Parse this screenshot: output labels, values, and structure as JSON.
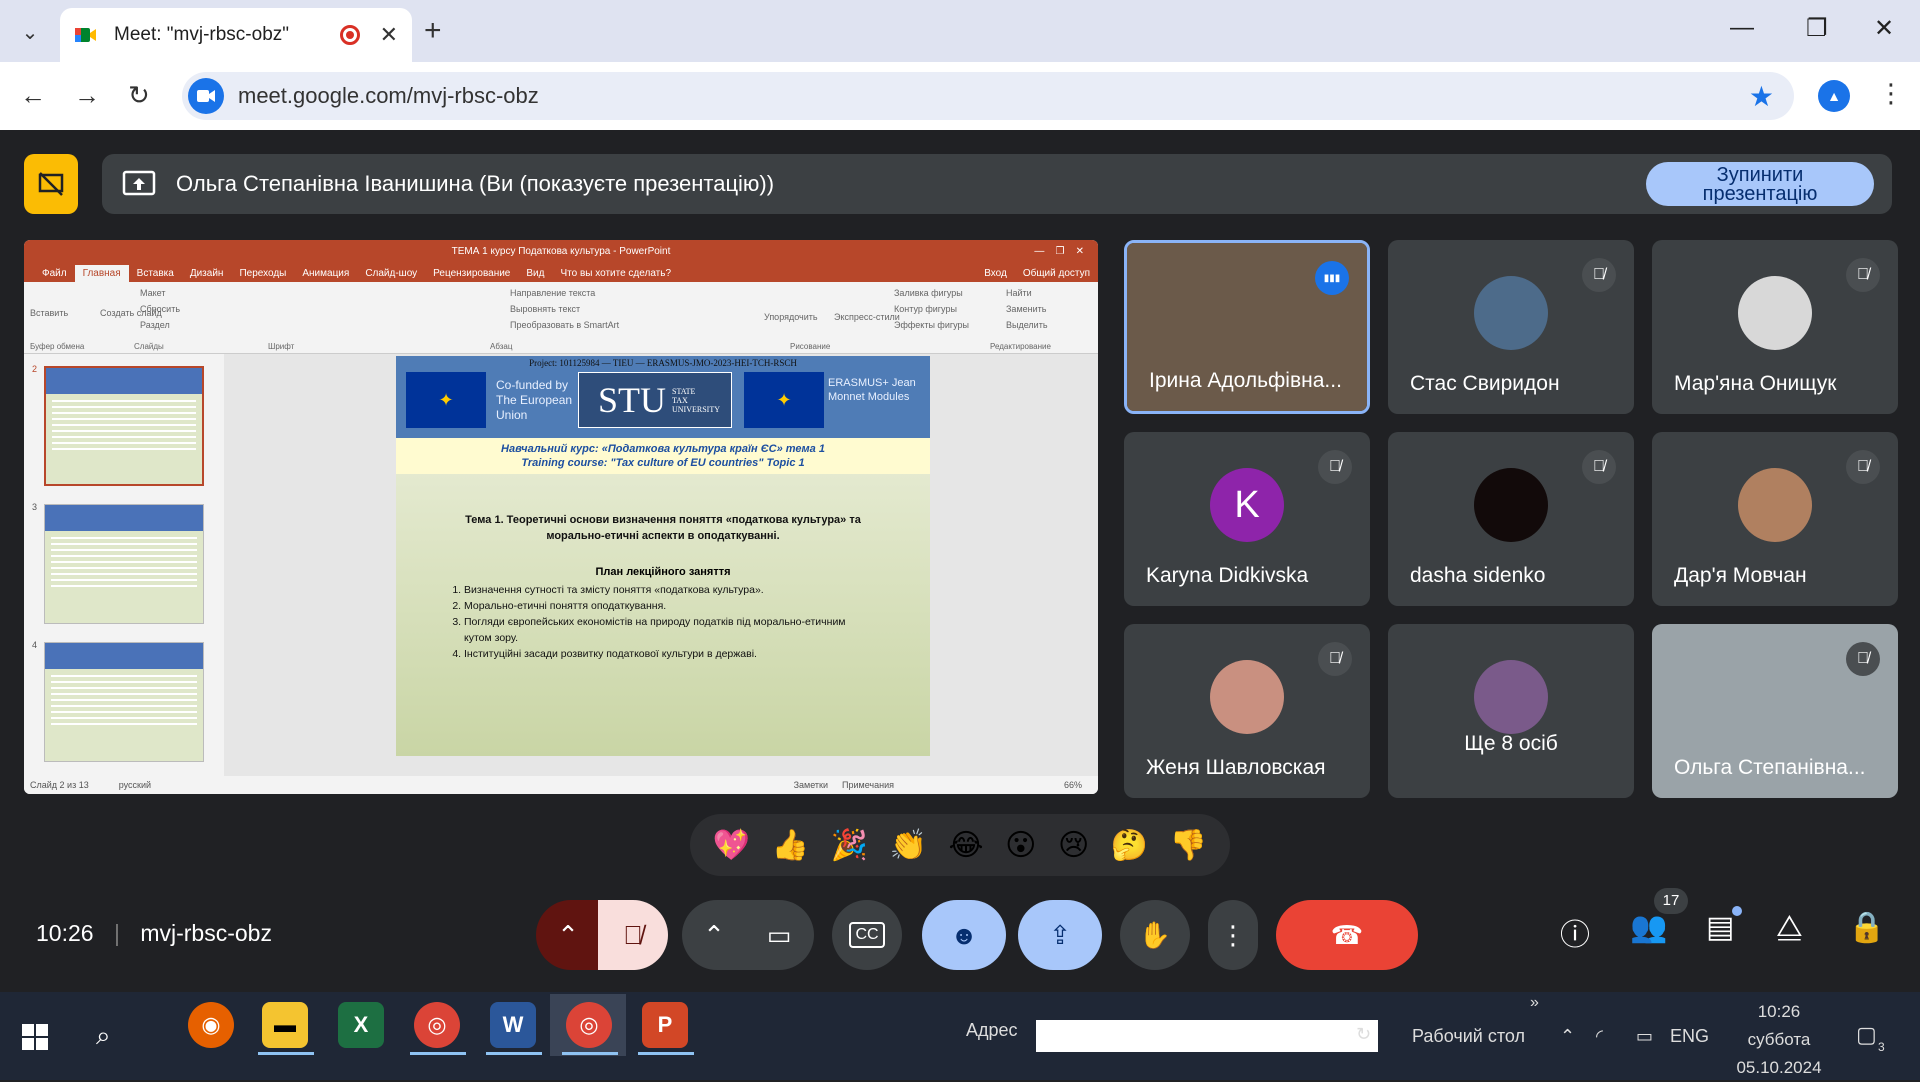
{
  "browser": {
    "tab_title": "Meet: \"mvj-rbsc-obz\"",
    "url": "meet.google.com/mvj-rbsc-obz",
    "minimize": "—",
    "restore": "❐",
    "close": "✕"
  },
  "presentation_bar": {
    "label": "Ольга Степанівна Іванишина (Ви (показуєте презентацію))",
    "stop_line1": "Зупинити",
    "stop_line2": "презентацію"
  },
  "powerpoint": {
    "window_title": "ТЕМА 1  курсу Податкова культура - PowerPoint",
    "menu": [
      "Файл",
      "Главная",
      "Вставка",
      "Дизайн",
      "Переходы",
      "Анимация",
      "Слайд-шоу",
      "Рецензирование",
      "Вид",
      "Что вы хотите сделать?"
    ],
    "login": "Вход",
    "share": "Общий доступ",
    "ribbon_groups": [
      "Буфер обмена",
      "Слайды",
      "Шрифт",
      "Абзац",
      "Рисование",
      "Редактирование"
    ],
    "ribbon_items": [
      "Вставить",
      "Создать слайд",
      "Макет",
      "Сбросить",
      "Раздел",
      "Направление текста",
      "Выровнять текст",
      "Преобразовать в SmartArt",
      "Упорядочить",
      "Экспресс-стили",
      "Заливка фигуры",
      "Контур фигуры",
      "Эффекты фигуры",
      "Найти",
      "Заменить",
      "Выделить"
    ],
    "thumb_numbers": [
      "2",
      "3",
      "4"
    ],
    "slide": {
      "project": "Project: 101125984 — TIEU — ERASMUS-JMO-2023-HEI-TCH-RSCH",
      "cofunded": "Co-funded by The European Union",
      "stu": "STU",
      "stu_sub": "STATE TAX UNIVERSITY",
      "erasmus": "ERASMUS+ Jean Monnet Modules",
      "course_ua": "Навчальний курс: «Податкова культура країн ЄС» тема 1",
      "course_en": "Training course: \"Tax culture of EU countries\" Topic 1",
      "topic": "Тема 1. Теоретичні основи визначення поняття «податкова культура» та морально-етичні аспекти в оподаткуванні.",
      "plan_title": "План лекційного заняття",
      "plan": [
        "Визначення сутності та змісту поняття «податкова культура».",
        "Морально-етичні поняття оподаткування.",
        "Погляди європейських економістів на природу податків під морально-етичним кутом зору.",
        "Інституційні засади розвитку податкової культури в державі."
      ]
    },
    "status": {
      "slide": "Слайд 2 из 13",
      "lang": "русский",
      "notes": "Заметки",
      "comments": "Примечания",
      "zoom": "66%"
    }
  },
  "participants": [
    {
      "name": "Ірина Адольфівна...",
      "initial": "",
      "color": "#6b5a4a",
      "muted": false,
      "speaking": true
    },
    {
      "name": "Стас Свиридон",
      "initial": "",
      "color": "#4d6b8a",
      "muted": true
    },
    {
      "name": "Мар'яна Онищук",
      "initial": "",
      "color": "#d8d8d8",
      "muted": true
    },
    {
      "name": "Karyna Didkivska",
      "initial": "K",
      "color": "#8e24aa",
      "muted": true
    },
    {
      "name": "dasha sidenko",
      "initial": "",
      "color": "#120a0a",
      "muted": true
    },
    {
      "name": "Дар'я Мовчан",
      "initial": "",
      "color": "#b08060",
      "muted": true
    },
    {
      "name": "Женя Шавловская",
      "initial": "",
      "color": "#c99080",
      "muted": true
    },
    {
      "name": "Ще 8 осіб",
      "initial": "",
      "color": "#7a5a8a",
      "muted": false
    },
    {
      "name": "Ольга Степанівна...",
      "initial": "",
      "color": "#9aa3a8",
      "muted": true
    }
  ],
  "reactions": [
    "💖",
    "👍",
    "🎉",
    "👏",
    "😂",
    "😮",
    "😢",
    "🤔",
    "👎"
  ],
  "meeting": {
    "time": "10:26",
    "code": "mvj-rbsc-obz",
    "people_count": "17"
  },
  "taskbar": {
    "address_label": "Адрес",
    "desktop": "Рабочий стол",
    "lang": "ENG",
    "time": "10:26",
    "day": "суббота",
    "date": "05.10.2024",
    "notif": "3",
    "apps": [
      "firefox",
      "explorer",
      "excel",
      "chrome",
      "word",
      "chrome-active",
      "powerpoint"
    ]
  },
  "colors": {
    "meet_bg": "#202124",
    "tile": "#3c4043",
    "accent": "#a8c7fa",
    "hangup": "#ea4335",
    "ppt": "#b7472a"
  }
}
